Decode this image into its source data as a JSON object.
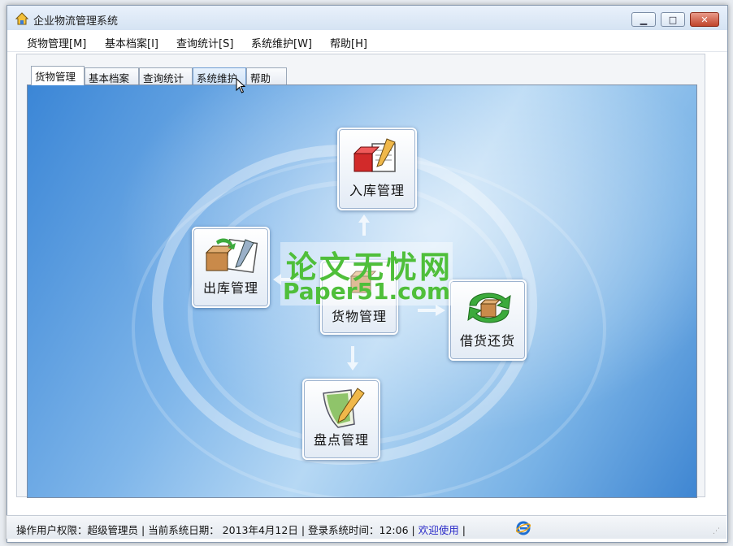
{
  "window": {
    "title": "企业物流管理系统"
  },
  "menu": [
    "货物管理[M]",
    "基本档案[I]",
    "查询统计[S]",
    "系统维护[W]",
    "帮助[H]"
  ],
  "tabs": [
    "货物管理",
    "基本档案",
    "查询统计",
    "系统维护",
    "帮助"
  ],
  "flow": {
    "inbound": "入库管理",
    "outbound": "出库管理",
    "center": "货物管理",
    "borrow": "借货还货",
    "inventory": "盘点管理"
  },
  "watermark": {
    "cn": "论文无忧网",
    "en": "Paper51.com"
  },
  "status": {
    "permission": "操作用户权限：超级管理员",
    "date": "当前系统日期： 2013年4月12日",
    "login": "登录系统时间：12:06",
    "welcome": "欢迎使用"
  },
  "colors": {
    "accent": "#3b86d6",
    "watermark": "#4fbf3a",
    "welcome": "#2a2ac8"
  },
  "icons": [
    "home-icon",
    "minimize-icon",
    "maximize-icon",
    "close-icon",
    "ie-icon"
  ]
}
